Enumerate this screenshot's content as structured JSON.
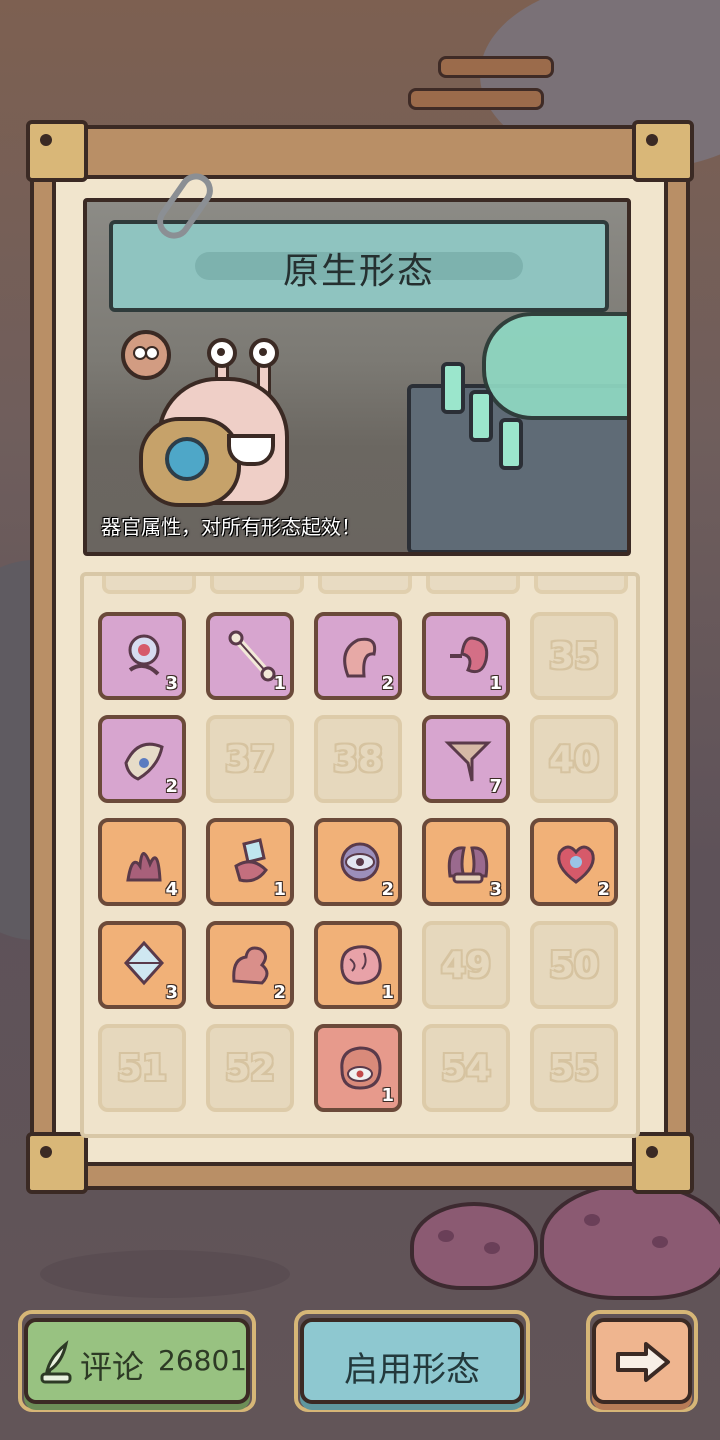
{
  "scene": {
    "title": "原生形态",
    "caption": "器官属性，对所有形态起效！"
  },
  "grid": {
    "slots": [
      {
        "state": "filled",
        "rarity": "purple",
        "icon": "orb-organ-icon",
        "count": "3"
      },
      {
        "state": "filled",
        "rarity": "purple",
        "icon": "bone-icon",
        "count": "1"
      },
      {
        "state": "filled",
        "rarity": "purple",
        "icon": "tentacle-icon",
        "count": "2"
      },
      {
        "state": "filled",
        "rarity": "purple",
        "icon": "kidney-icon",
        "count": "1"
      },
      {
        "state": "empty",
        "number": "35"
      },
      {
        "state": "filled",
        "rarity": "purple",
        "icon": "claw-organ-icon",
        "count": "2"
      },
      {
        "state": "empty",
        "number": "37"
      },
      {
        "state": "empty",
        "number": "38"
      },
      {
        "state": "filled",
        "rarity": "purple",
        "icon": "stinger-icon",
        "count": "7"
      },
      {
        "state": "empty",
        "number": "40"
      },
      {
        "state": "filled",
        "rarity": "orange",
        "icon": "coral-organ-icon",
        "count": "4"
      },
      {
        "state": "filled",
        "rarity": "orange",
        "icon": "crystal-organ-icon",
        "count": "1"
      },
      {
        "state": "filled",
        "rarity": "orange",
        "icon": "eye-orb-icon",
        "count": "2"
      },
      {
        "state": "filled",
        "rarity": "orange",
        "icon": "horns-icon",
        "count": "3"
      },
      {
        "state": "filled",
        "rarity": "orange",
        "icon": "heart-organ-icon",
        "count": "2"
      },
      {
        "state": "filled",
        "rarity": "orange",
        "icon": "crystal-core-icon",
        "count": "3"
      },
      {
        "state": "filled",
        "rarity": "orange",
        "icon": "muscle-arm-icon",
        "count": "2"
      },
      {
        "state": "filled",
        "rarity": "orange",
        "icon": "brain-icon",
        "count": "1"
      },
      {
        "state": "empty",
        "number": "49"
      },
      {
        "state": "empty",
        "number": "50"
      },
      {
        "state": "empty",
        "number": "51"
      },
      {
        "state": "empty",
        "number": "52"
      },
      {
        "state": "filled",
        "rarity": "red",
        "icon": "eye-brain-icon",
        "count": "1"
      },
      {
        "state": "empty",
        "number": "54"
      },
      {
        "state": "empty",
        "number": "55"
      }
    ]
  },
  "footer": {
    "comment_label": "评论",
    "comment_count": "26801",
    "apply_label": "启用形态",
    "next_icon": "arrow-right-icon"
  },
  "colors": {
    "purple": "#d7a5cf",
    "orange": "#f1b178",
    "red": "#e79a8c",
    "empty": "#e6d8bd"
  }
}
